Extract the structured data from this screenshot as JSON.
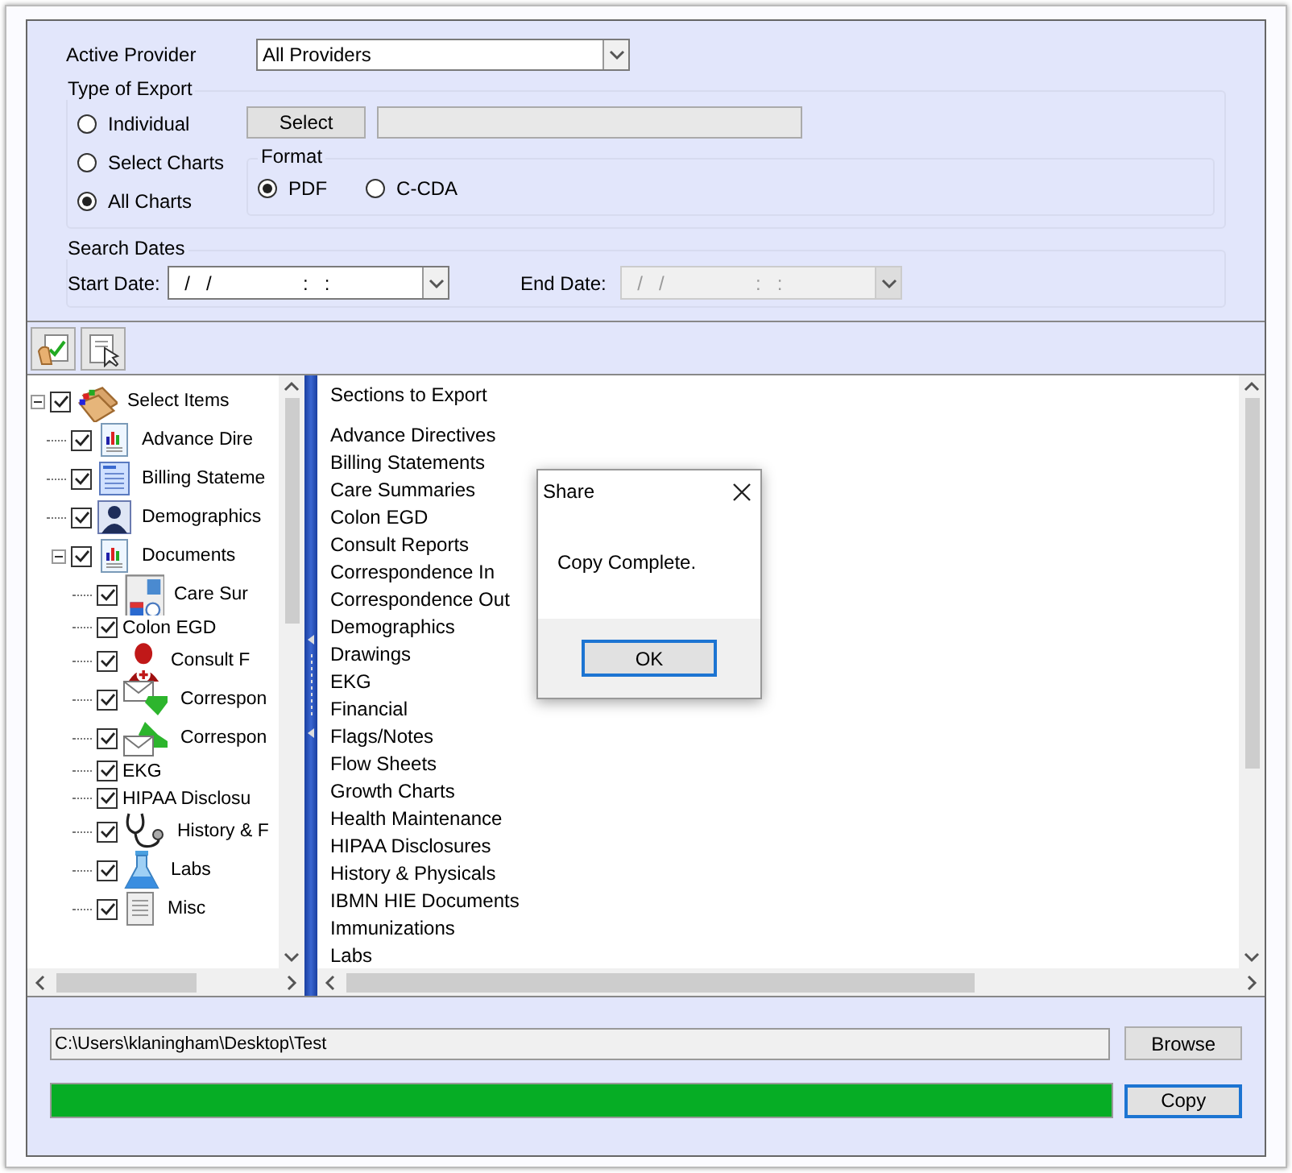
{
  "provider": {
    "label": "Active Provider",
    "value": "All Providers"
  },
  "export_type": {
    "legend": "Type of Export",
    "options": [
      {
        "label": "Individual",
        "selected": false
      },
      {
        "label": "Select Charts",
        "selected": false
      },
      {
        "label": "All Charts",
        "selected": true
      }
    ],
    "select_button": "Select"
  },
  "format": {
    "legend": "Format",
    "options": [
      {
        "label": "PDF",
        "selected": true
      },
      {
        "label": "C-CDA",
        "selected": false
      }
    ]
  },
  "search_dates": {
    "legend": "Search Dates",
    "start": {
      "label": "Start Date:",
      "value": "/   /                 :   :",
      "disabled": false
    },
    "end": {
      "label": "End Date:",
      "value": "/   /                 :   :",
      "disabled": true
    }
  },
  "tree": {
    "label": "Select Items",
    "checked": true,
    "expanded": true,
    "children": [
      {
        "label": "Advance Dire",
        "checked": true
      },
      {
        "label": "Billing Stateme",
        "checked": true
      },
      {
        "label": "Demographics",
        "checked": true
      },
      {
        "label": "Documents",
        "checked": true,
        "expanded": true,
        "children": [
          {
            "label": "Care Sur",
            "checked": true
          },
          {
            "label": "Colon EGD",
            "checked": true
          },
          {
            "label": "Consult F",
            "checked": true
          },
          {
            "label": "Correspon",
            "checked": true
          },
          {
            "label": "Correspon",
            "checked": true
          },
          {
            "label": "EKG",
            "checked": true
          },
          {
            "label": "HIPAA Disclosu",
            "checked": true
          },
          {
            "label": "History & F",
            "checked": true
          },
          {
            "label": "Labs",
            "checked": true
          },
          {
            "label": "Misc",
            "checked": true
          }
        ]
      }
    ]
  },
  "sections": {
    "title": "Sections to Export",
    "items": [
      "Advance Directives",
      "Billing Statements",
      "Care Summaries",
      "Colon EGD",
      "Consult Reports",
      "Correspondence In",
      "Correspondence Out",
      "Demographics",
      "Drawings",
      "EKG",
      "Financial",
      "Flags/Notes",
      "Flow Sheets",
      "Growth Charts",
      "Health Maintenance",
      "HIPAA Disclosures",
      "History & Physicals",
      "IBMN HIE Documents",
      "Immunizations",
      "Labs"
    ]
  },
  "dialog": {
    "title": "Share",
    "message": "Copy Complete.",
    "button": "OK"
  },
  "path": {
    "value": "C:\\Users\\klaningham\\Desktop\\Test",
    "button": "Browse"
  },
  "progress": {
    "level": 1,
    "button": "Copy"
  }
}
